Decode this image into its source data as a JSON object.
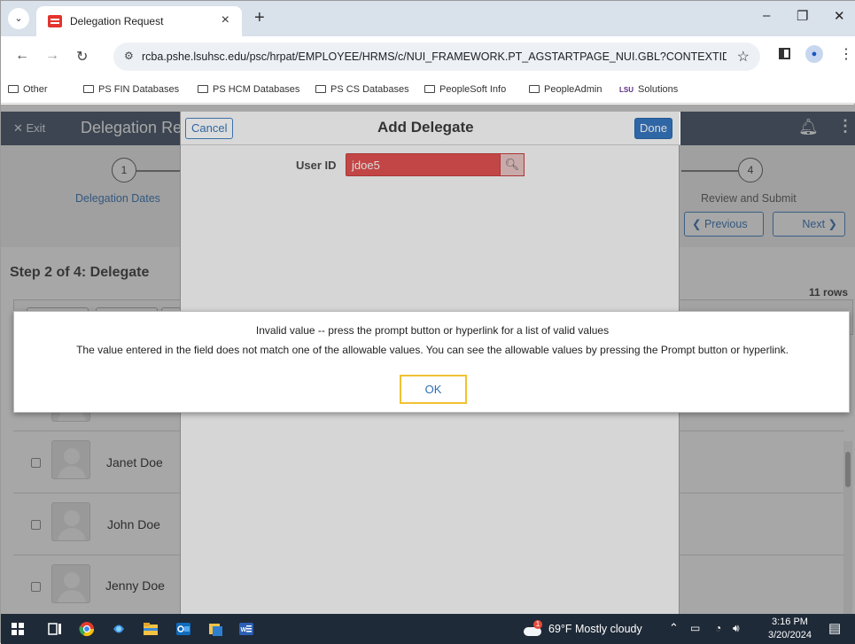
{
  "browser": {
    "tab_title": "Delegation Request",
    "tab_close": "×",
    "new_tab": "+",
    "url": "rcba.pshe.lsuhsc.edu/psc/hrpat/EMPLOYEE/HRMS/c/NUI_FRAMEWORK.PT_AGSTARTPAGE_NUI.GBL?CONTEXTIDP...",
    "bookmarks": [
      "Other",
      "PS FIN Databases",
      "PS HCM Databases",
      "PS CS Databases",
      "PeopleSoft Info",
      "PeopleAdmin",
      "Solutions"
    ],
    "lsu_logo": "LSU"
  },
  "banner": {
    "exit_label": "Exit",
    "title": "Delegation Request"
  },
  "steps": [
    {
      "number": "1",
      "label": "Delegation Dates"
    },
    {
      "number": "4",
      "label": "Review and Submit"
    }
  ],
  "pager": {
    "previous": "Previous",
    "next": "Next"
  },
  "step_heading": "Step 2 of 4: Delegate",
  "rows_count": "11 rows",
  "people": [
    {
      "name": "Janet Doe"
    },
    {
      "name": "John Doe"
    },
    {
      "name": "Jenny Doe"
    }
  ],
  "modal": {
    "title": "Add Delegate",
    "cancel": "Cancel",
    "done": "Done",
    "user_id_label": "User ID",
    "user_id_value": "jdoe5"
  },
  "error": {
    "line1": "Invalid value -- press the prompt button or hyperlink for a list of valid values",
    "line2": "The value entered in the field does not match one of the allowable values.  You can see the allowable values by pressing the Prompt button or hyperlink.",
    "ok": "OK"
  },
  "taskbar": {
    "weather": "69°F  Mostly cloudy",
    "time": "3:16 PM",
    "date": "3/20/2024",
    "weather_badge": "1"
  },
  "colors": {
    "banner": "#3d4d63",
    "error_field": "#e04848",
    "ok_border": "#f0c232",
    "link_blue": "#2e6fb5"
  }
}
